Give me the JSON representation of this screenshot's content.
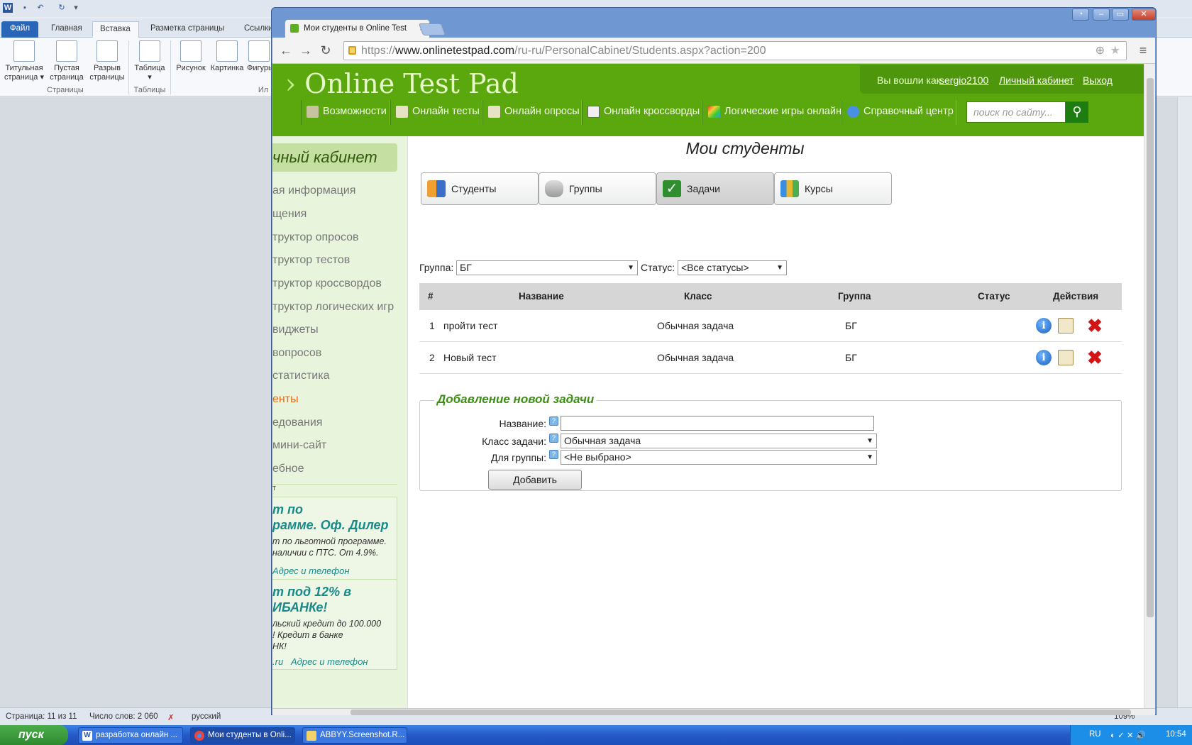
{
  "word": {
    "tabs": [
      "Файл",
      "Главная",
      "Вставка",
      "Разметка страницы",
      "Ссылки"
    ],
    "ribbon_buttons": [
      {
        "label": "Титульная страница ▾"
      },
      {
        "label": "Пустая страница"
      },
      {
        "label": "Разрыв страницы"
      },
      {
        "label": "Таблица ▾"
      },
      {
        "label": "Рисунок"
      },
      {
        "label": "Картинка"
      },
      {
        "label": "Фигуры"
      }
    ],
    "groups": [
      "Страницы",
      "Таблицы",
      "Ил"
    ],
    "status": {
      "page": "Страница: 11 из 11",
      "words": "Число слов: 2 060",
      "lang": "русский",
      "zoom": "109%"
    }
  },
  "chrome": {
    "tab_title": "Мои студенты в Online Test",
    "tab_close": "×",
    "url_scheme": "https://",
    "url_host": "www.onlinetestpad.com",
    "url_path": "/ru-ru/PersonalCabinet/Students.aspx?action=200"
  },
  "site": {
    "logo": "Online Test Pad",
    "logged_in_as": "Вы вошли как",
    "username": "sergio2100",
    "cabinet_link": "Личный кабинет",
    "logout": "Выход",
    "nav": [
      {
        "label": "Возможности",
        "icon": "gears-icon"
      },
      {
        "label": "Онлайн тесты",
        "icon": "test-icon"
      },
      {
        "label": "Онлайн опросы",
        "icon": "poll-icon"
      },
      {
        "label": "Онлайн кроссворды",
        "icon": "crossword-icon"
      },
      {
        "label": "Логические игры онлайн",
        "icon": "puzzle-icon"
      },
      {
        "label": "Справочный центр",
        "icon": "help-icon"
      }
    ],
    "search_placeholder": "поиск по сайту..."
  },
  "sidebar": {
    "title": "чный кабинет",
    "items": [
      "ая информация",
      "щения",
      "труктор опросов",
      "труктор тестов",
      "труктор кроссвордов",
      "труктор логических игр",
      "виджеты",
      "вопросов",
      "статистика",
      "енты",
      "едования",
      "мини-сайт",
      "ебное"
    ],
    "current_index": 9,
    "ad_label": "т",
    "ads": [
      {
        "title_1": "т по",
        "title_2": "рамме. Оф. Дилер",
        "body_1": "т по льготной программе.",
        "body_2": "наличии с ПТС. От 4.9%.",
        "link_1": "Адрес и телефон",
        "link_2": ""
      },
      {
        "title_1": "т под 12% в",
        "title_2": "ИБАНКе!",
        "body_1": "льский кредит до 100.000",
        "body_2": "! Кредит в банке",
        "body_3": "НК!",
        "link_1": ".ru",
        "link_2": "Адрес и телефон"
      }
    ]
  },
  "main": {
    "title": "Мои студенты",
    "tabs": [
      {
        "label": "Студенты",
        "icon": "students-icon"
      },
      {
        "label": "Группы",
        "icon": "database-icon"
      },
      {
        "label": "Задачи",
        "icon": "checkmark-icon"
      },
      {
        "label": "Курсы",
        "icon": "courses-icon"
      }
    ],
    "active_tab": 2,
    "filter": {
      "group_label": "Группа:",
      "group_value": "БГ",
      "status_label": "Статус:",
      "status_value": "<Все статусы>"
    },
    "table": {
      "headers": [
        "#",
        "Название",
        "Класс",
        "Группа",
        "Статус",
        "Действия"
      ],
      "rows": [
        {
          "num": "1",
          "name": "пройти тест",
          "class": "Обычная задача",
          "group": "БГ",
          "status": ""
        },
        {
          "num": "2",
          "name": "Новый тест",
          "class": "Обычная задача",
          "group": "БГ",
          "status": ""
        }
      ]
    },
    "add_form": {
      "legend": "Добавление новой задачи",
      "name_label": "Название:",
      "name_value": "",
      "class_label": "Класс задачи:",
      "class_value": "Обычная задача",
      "group_label": "Для группы:",
      "group_value": "<Не выбрано>",
      "submit": "Добавить"
    }
  },
  "taskbar": {
    "start": "пуск",
    "buttons": [
      {
        "label": "разработка онлайн ...",
        "icon": "word-icon"
      },
      {
        "label": "Мои студенты в Onli...",
        "icon": "chrome-icon"
      },
      {
        "label": "ABBYY.Screenshot.R...",
        "icon": "folder-icon"
      }
    ],
    "lang": "RU",
    "clock": "10:54"
  },
  "colors": {
    "site_green": "#5aa80e",
    "legend_green": "#3e8e16",
    "taskbar_blue": "#2459c7",
    "delete_red": "#d21414"
  }
}
